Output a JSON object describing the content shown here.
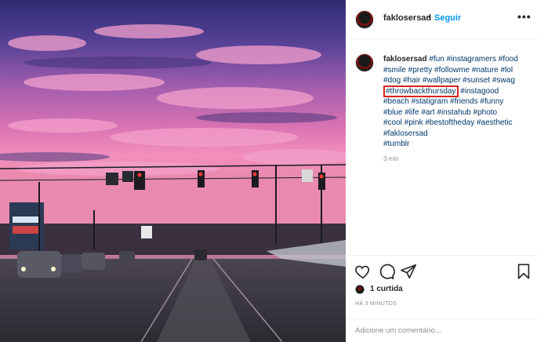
{
  "post": {
    "image_alt": "purple sunset sky over a road with traffic lights"
  },
  "header": {
    "username": "faklosersad",
    "separator": "•",
    "follow_label": "Seguir",
    "more_label": "•••"
  },
  "caption": {
    "username": "faklosersad",
    "line1": "#fun #instagramers #food",
    "line2": "#smile #pretty #followme #nature #lol",
    "line3": "#dog #hair #wallpaper #sunset #swag",
    "highlighted_tag": "#throwbackthursday",
    "line4_rest": " #instagood",
    "line5": "#beach #statigram #friends #funny",
    "line6": "#blue #life #art #instahub #photo",
    "line7": "#cool #pink #bestoftheday #aesthetic",
    "line8": "#faklosersad",
    "line9": "#tumblr",
    "time_ago": "3 min",
    "highlight_color": "#d9221c"
  },
  "actions": {
    "like_icon": "heart-icon",
    "comment_icon": "comment-icon",
    "share_icon": "share-icon",
    "save_icon": "bookmark-icon",
    "likes_text": "1 curtida",
    "posted_text": "HÁ 3 MINUTOS",
    "comment_placeholder": "Adicione um comentário..."
  },
  "colors": {
    "link": "#0095f6",
    "hashtag": "#00376b",
    "muted": "#8e8e8e"
  }
}
